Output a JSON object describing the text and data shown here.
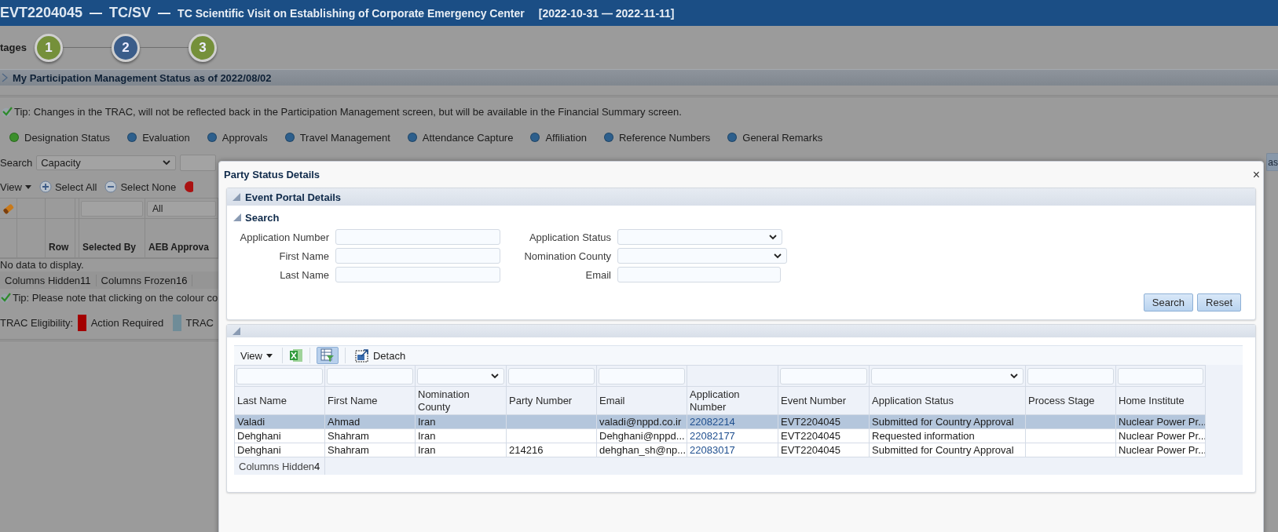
{
  "header": {
    "event_code": "EVT2204045",
    "separator_1": "—",
    "type": "TC/SV",
    "separator_2": "—",
    "title": "TC Scientific Visit on Establishing of Corporate Emergency Center",
    "date_range": "[2022-10-31 — 2022-11-11]"
  },
  "stages": {
    "label": "tages",
    "steps": [
      {
        "number": "1",
        "color": "#75903a"
      },
      {
        "number": "2",
        "color": "#3b5d8a"
      },
      {
        "number": "3",
        "color": "#75903a"
      }
    ]
  },
  "status_section": {
    "title": "My Participation Management Status as of 2022/08/02",
    "expanded": false
  },
  "tip_1": "Tip: Changes in the TRAC, will not be reflected back in the Participation Management screen, but will be available in the Financial Summary screen.",
  "status_tabs": [
    {
      "label": "Designation Status",
      "color": "#3c8f2c"
    },
    {
      "label": "Evaluation",
      "color": "#2d5f8c"
    },
    {
      "label": "Approvals",
      "color": "#2d5f8c"
    },
    {
      "label": "Travel Management",
      "color": "#2d5f8c"
    },
    {
      "label": "Attendance Capture",
      "color": "#2d5f8c"
    },
    {
      "label": "Affiliation",
      "color": "#2d5f8c"
    },
    {
      "label": "Reference Numbers",
      "color": "#2d5f8c"
    },
    {
      "label": "General Remarks",
      "color": "#2d5f8c"
    }
  ],
  "search": {
    "label": "Search",
    "value": "Capacity",
    "right_button": "as"
  },
  "toolbar": {
    "view": "View",
    "select_all": "Select All",
    "select_none": "Select None"
  },
  "grid": {
    "filter_value": "All",
    "columns": [
      "Row",
      "Selected By",
      "AEB Approva"
    ],
    "empty_text": "No data to display.",
    "status": [
      {
        "label": "Columns Hidden",
        "count": "11"
      },
      {
        "label": "Columns Frozen",
        "count": "16"
      }
    ]
  },
  "tip_2": "Tip: Please note that clicking on the colour co",
  "legend": {
    "label": "TRAC Eligibility:",
    "items": [
      {
        "label": "Action Required",
        "color": "#a30000"
      },
      {
        "label": "TRAC",
        "color": "#6f8c98"
      }
    ]
  },
  "dialog": {
    "title": "Party Status Details",
    "close": "×",
    "panel": {
      "title": "Event Portal Details",
      "expanded": true
    },
    "search": {
      "title": "Search",
      "expanded": true,
      "fields": [
        {
          "label": "Application Number",
          "kind": "text"
        },
        {
          "label": "Application Status",
          "kind": "select"
        },
        {
          "label": "First Name",
          "kind": "text"
        },
        {
          "label": "Nomination County",
          "kind": "select"
        },
        {
          "label": "Last Name",
          "kind": "text"
        },
        {
          "label": "Email",
          "kind": "text"
        }
      ],
      "buttons": [
        "Search",
        "Reset"
      ]
    },
    "results": {
      "expanded": true,
      "view": "View",
      "filter_toggle_on": true,
      "detach": "Detach",
      "filters": [
        {
          "kind": "text"
        },
        {
          "kind": "text"
        },
        {
          "kind": "select"
        },
        {
          "kind": "text"
        },
        {
          "kind": "text"
        },
        {
          "kind": "none"
        },
        {
          "kind": "text"
        },
        {
          "kind": "select"
        },
        {
          "kind": "text"
        },
        {
          "kind": "text"
        }
      ],
      "columns": [
        {
          "label": "Last Name"
        },
        {
          "label": "First Name"
        },
        {
          "label": "Nomination County"
        },
        {
          "label": "Party Number"
        },
        {
          "label": "Email"
        },
        {
          "label": "Application Number"
        },
        {
          "label": "Event Number"
        },
        {
          "label": "Application Status"
        },
        {
          "label": "Process Stage"
        },
        {
          "label": "Home Institute"
        }
      ],
      "rows": [
        {
          "selected": true,
          "cells": [
            "Valadi",
            "Ahmad",
            "Iran",
            null,
            "valadi@nppd.co.ir",
            {
              "link": "22082214"
            },
            "EVT2204045",
            "Submitted for Country Approval",
            null,
            "Nuclear Power Pr..."
          ]
        },
        {
          "selected": false,
          "cells": [
            "Dehghani",
            "Shahram",
            "Iran",
            null,
            "Dehghani@nppd...",
            {
              "link": "22082177"
            },
            "EVT2204045",
            "Requested information",
            null,
            "Nuclear Power Pr..."
          ]
        },
        {
          "selected": false,
          "cells": [
            "Dehghani",
            "Shahram",
            "Iran",
            "214216",
            "dehghan_sh@np...",
            {
              "link": "22083017"
            },
            "EVT2204045",
            "Submitted for Country Approval",
            null,
            "Nuclear Power Pr..."
          ]
        }
      ],
      "status": {
        "label": "Columns Hidden",
        "count": "4"
      }
    }
  }
}
